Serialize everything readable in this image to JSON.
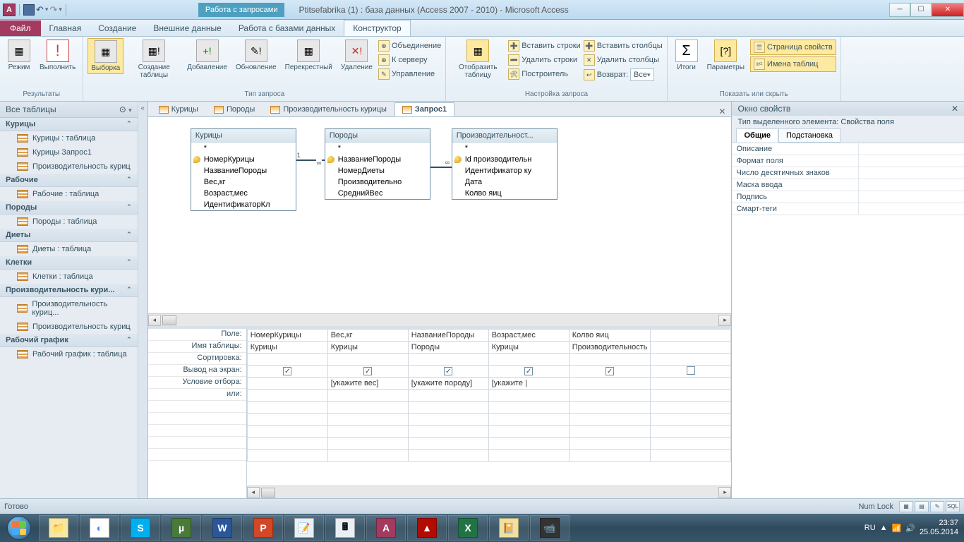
{
  "titlebar": {
    "context_tab": "Работа с запросами",
    "title": "Ptitsefabrika (1) : база данных (Access 2007 - 2010)  -  Microsoft Access"
  },
  "ribbon_tabs": {
    "file": "Файл",
    "home": "Главная",
    "create": "Создание",
    "external": "Внешние данные",
    "dbtools": "Работа с базами данных",
    "design": "Конструктор"
  },
  "ribbon": {
    "results": {
      "view": "Режим",
      "run": "Выполнить",
      "label": "Результаты"
    },
    "qtype": {
      "select": "Выборка",
      "maketable": "Создание\nтаблицы",
      "append": "Добавление",
      "update": "Обновление",
      "crosstab": "Перекрестный",
      "delete": "Удаление",
      "union": "Объединение",
      "passthrough": "К серверу",
      "datadef": "Управление",
      "label": "Тип запроса"
    },
    "setup": {
      "showtable": "Отобразить\nтаблицу",
      "ins_rows": "Вставить строки",
      "del_rows": "Удалить строки",
      "builder": "Построитель",
      "ins_cols": "Вставить столбцы",
      "del_cols": "Удалить столбцы",
      "return_lbl": "Возврат:",
      "return_val": "Все",
      "label": "Настройка запроса"
    },
    "showhide": {
      "totals": "Итоги",
      "params": "Параметры",
      "propsheet": "Страница свойств",
      "tablenames": "Имена таблиц",
      "label": "Показать или скрыть"
    }
  },
  "nav": {
    "header": "Все таблицы",
    "groups": [
      {
        "title": "Курицы",
        "items": [
          "Курицы : таблица",
          "Курицы Запрос1",
          "Производительность куриц"
        ]
      },
      {
        "title": "Рабочие",
        "items": [
          "Рабочие : таблица"
        ]
      },
      {
        "title": "Породы",
        "items": [
          "Породы : таблица"
        ]
      },
      {
        "title": "Диеты",
        "items": [
          "Диеты : таблица"
        ]
      },
      {
        "title": "Клетки",
        "items": [
          "Клетки : таблица"
        ]
      },
      {
        "title": "Производительность кури...",
        "items": [
          "Производительность куриц...",
          "Производительность куриц"
        ]
      },
      {
        "title": "Рабочий график",
        "items": [
          "Рабочий график : таблица"
        ]
      }
    ]
  },
  "doc_tabs": {
    "t1": "Курицы",
    "t2": "Породы",
    "t3": "Производительность курицы",
    "t4": "Запрос1"
  },
  "tables": {
    "t1": {
      "title": "Курицы",
      "star": "*",
      "f1": "НомерКурицы",
      "f2": "НазваниеПороды",
      "f3": "Вес,кг",
      "f4": "Возраст,мес",
      "f5": "ИдентификаторКл"
    },
    "t2": {
      "title": "Породы",
      "star": "*",
      "f1": "НазваниеПороды",
      "f2": "НомерДиеты",
      "f3": "Производительно",
      "f4": "СреднийВес"
    },
    "t3": {
      "title": "Производительност...",
      "star": "*",
      "f1": "Id производительн",
      "f2": "Идентификатор ку",
      "f3": "Дата",
      "f4": "Колво яиц"
    }
  },
  "grid": {
    "labels": {
      "field": "Поле:",
      "table": "Имя таблицы:",
      "sort": "Сортировка:",
      "show": "Вывод на экран:",
      "criteria": "Условие отбора:",
      "or": "или:"
    },
    "cols": [
      {
        "field": "НомерКурицы",
        "table": "Курицы",
        "show": true,
        "criteria": ""
      },
      {
        "field": "Вес,кг",
        "table": "Курицы",
        "show": true,
        "criteria": "[укажите вес]"
      },
      {
        "field": "НазваниеПороды",
        "table": "Породы",
        "show": true,
        "criteria": "[укажите породу]"
      },
      {
        "field": "Возраст,мес",
        "table": "Курицы",
        "show": true,
        "criteria": "[укажите |"
      },
      {
        "field": "Колво яиц",
        "table": "Производительность",
        "show": true,
        "criteria": ""
      },
      {
        "field": "",
        "table": "",
        "show": false,
        "criteria": ""
      }
    ]
  },
  "prop": {
    "title": "Окно свойств",
    "subtitle": "Тип выделенного элемента:  Свойства поля",
    "tab_general": "Общие",
    "tab_lookup": "Подстановка",
    "rows": [
      "Описание",
      "Формат поля",
      "Число десятичных знаков",
      "Маска ввода",
      "Подпись",
      "Смарт-теги"
    ]
  },
  "status": {
    "ready": "Готово",
    "numlock": "Num Lock"
  },
  "tray": {
    "lang": "RU",
    "time": "23:37",
    "date": "25.05.2014"
  }
}
